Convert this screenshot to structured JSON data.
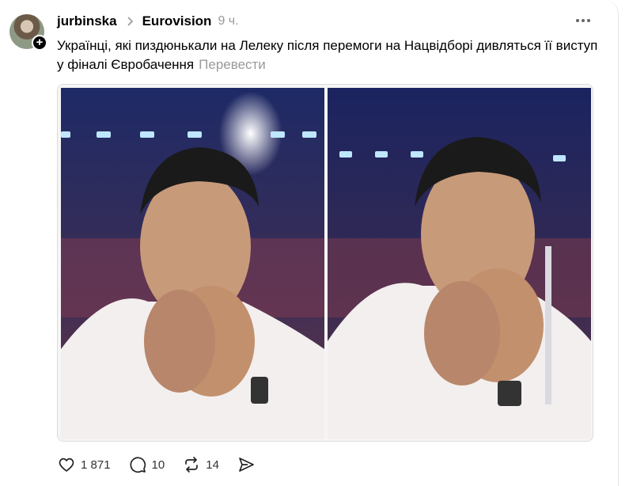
{
  "post": {
    "username": "jurbinska",
    "community": "Eurovision",
    "time": "9 ч.",
    "text": "Українці, які пиздюнькали на Лелеку після перемоги на Нацвідборі дивляться її виступ у фіналі Євробачення",
    "translate_label": "Перевести"
  },
  "media": {
    "images": [
      {
        "description_icon": "photo-icon"
      },
      {
        "description_icon": "photo-icon"
      }
    ]
  },
  "actions": {
    "likes": "1 871",
    "comments": "10",
    "reposts": "14"
  },
  "icons": {
    "like": "heart-icon",
    "comment": "comment-icon",
    "repost": "repost-icon",
    "share": "share-icon",
    "more": "more-icon",
    "chevron": "chevron-right-icon"
  },
  "colors": {
    "muted": "#999999",
    "text": "#000000"
  }
}
